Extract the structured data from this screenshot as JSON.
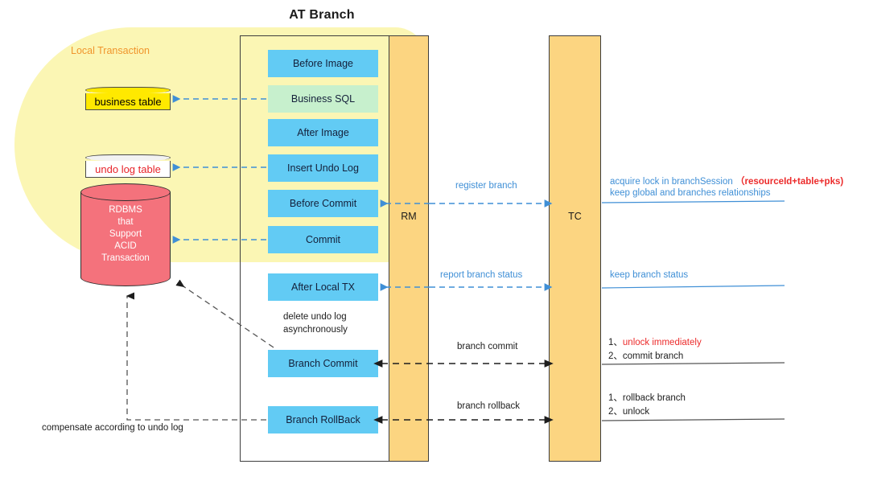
{
  "diagram": {
    "title": "AT Branch",
    "local_transaction_label": "Local Transaction"
  },
  "actors": {
    "rm": "RM",
    "tc": "TC"
  },
  "steps": [
    {
      "label": "Before Image",
      "color": "#62cbf4"
    },
    {
      "label": "Business SQL",
      "color": "#c7f0cd"
    },
    {
      "label": "After Image",
      "color": "#62cbf4"
    },
    {
      "label": "Insert Undo Log",
      "color": "#62cbf4"
    },
    {
      "label": "Before Commit",
      "color": "#62cbf4"
    },
    {
      "label": "Commit",
      "color": "#62cbf4"
    },
    {
      "label": "After Local TX",
      "color": "#62cbf4"
    },
    {
      "label": "Branch Commit",
      "color": "#62cbf4"
    },
    {
      "label": "Branch RollBack",
      "color": "#62cbf4"
    }
  ],
  "datastores": {
    "business_table": "business table",
    "undo_log_table": "undo log table",
    "rdbms": [
      "RDBMS",
      "that",
      "Support",
      "ACID",
      "Transaction"
    ]
  },
  "messages": {
    "register_branch": "register branch",
    "report_branch_status": "report branch status",
    "branch_commit": "branch commit",
    "branch_rollback": "branch rollback"
  },
  "tc_notes": {
    "acquire_lock_prefix": "acquire lock in branchSession",
    "acquire_lock_key": "（resourceId+table+pks)",
    "keep_relationships": "keep global and branches relationships",
    "keep_branch_status": "keep branch status",
    "commit_line1_num": "1、",
    "commit_line1_text": "unlock immediately",
    "commit_line2_num": "2、",
    "commit_line2_text": "commit branch",
    "rollback_line1_num": "1、",
    "rollback_line1_text": "rollback branch",
    "rollback_line2_num": "2、",
    "rollback_line2_text": "unlock"
  },
  "annotations": {
    "delete_undo_log_l1": "delete undo log",
    "delete_undo_log_l2": "asynchronously",
    "compensate": "compensate according to undo log"
  },
  "colors": {
    "step_blue": "#62cbf4",
    "step_green": "#c7f0cd",
    "column_orange": "#fcd581",
    "local_yellow": "#fbf6b4",
    "rdbms_red": "#f4727c",
    "business_yellow": "#ffe900",
    "accent_blue": "#3f8fd6",
    "accent_red": "#ec2b2b",
    "label_orange": "#f0952c"
  }
}
